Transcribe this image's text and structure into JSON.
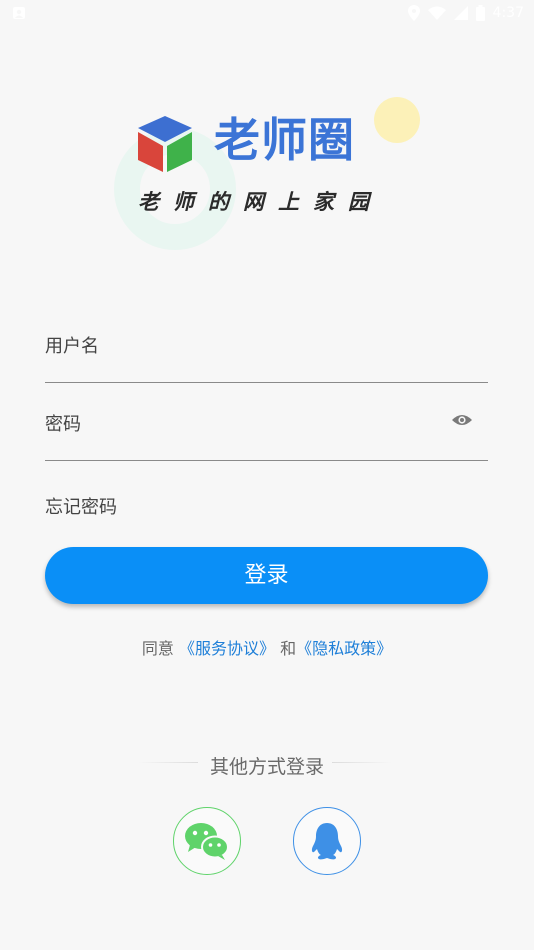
{
  "status_bar": {
    "time": "4:37",
    "icons": [
      "notification-icon",
      "location-icon",
      "wifi-icon",
      "signal-icon",
      "battery-icon"
    ]
  },
  "brand": {
    "title": "老师圈",
    "slogan": "老师的网上家园",
    "colors": {
      "title": "#3b74d6",
      "cube_top": "#3d6fd1",
      "cube_left": "#d9453b",
      "cube_right": "#3fb24a"
    }
  },
  "form": {
    "username_placeholder": "用户名",
    "password_placeholder": "密码",
    "password_toggle_icon": "eye-icon",
    "forgot_password": "忘记密码"
  },
  "login_button": {
    "label": "登录",
    "color": "#0a8ff7"
  },
  "agreement": {
    "prefix": "同意 ",
    "service_link": "《服务协议》",
    "middle": " 和",
    "privacy_link": "《隐私政策》"
  },
  "other_login": {
    "title": "其他方式登录",
    "providers": [
      {
        "name": "wechat",
        "icon": "wechat-icon",
        "color": "#5fd36a"
      },
      {
        "name": "qq",
        "icon": "qq-icon",
        "color": "#3e90e6"
      }
    ]
  }
}
